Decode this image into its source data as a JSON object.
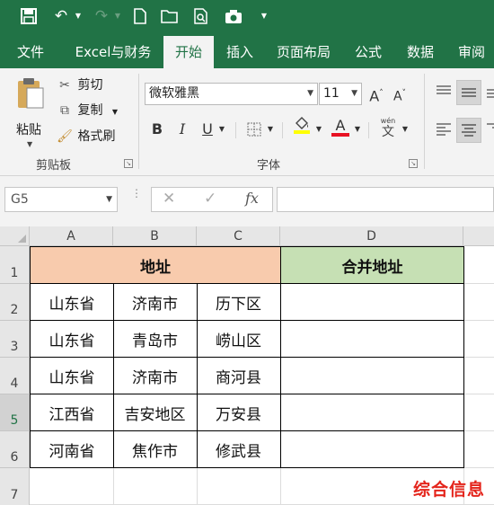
{
  "quick_access": {
    "icons": [
      "save-icon",
      "undo-icon",
      "undo-dropdown-icon",
      "redo-icon",
      "redo-dropdown-icon",
      "new-file-icon",
      "open-folder-icon",
      "print-preview-icon",
      "camera-icon",
      "customize-dropdown-icon"
    ]
  },
  "ribbon_tabs": [
    "文件",
    "Excel与财务",
    "开始",
    "插入",
    "页面布局",
    "公式",
    "数据",
    "审阅"
  ],
  "active_tab": "开始",
  "clipboard": {
    "paste_label": "粘贴",
    "cut_label": "剪切",
    "copy_label": "复制",
    "format_painter_label": "格式刷",
    "group_label": "剪贴板"
  },
  "font": {
    "font_name": "微软雅黑",
    "font_size": "11",
    "increase_label": "A",
    "decrease_label": "A",
    "bold_label": "B",
    "italic_label": "I",
    "underline_label": "U",
    "phonetic_label": "wén",
    "phonetic_char": "文",
    "font_color_label": "A",
    "fill_color": "#ffff00",
    "font_color": "#e81123",
    "group_label": "字体"
  },
  "formula_bar": {
    "name_box": "G5",
    "cancel_icon": "✕",
    "enter_icon": "✓",
    "fx_label": "fx",
    "value": ""
  },
  "sheet": {
    "columns": [
      "A",
      "B",
      "C",
      "D"
    ],
    "rows": [
      "1",
      "2",
      "3",
      "4",
      "5",
      "6",
      "7"
    ],
    "selected_row": "5",
    "header_merged_label": "地址",
    "header_merged_color": "#f8cbad",
    "header_d_label": "合并地址",
    "header_d_color": "#c6e0b4",
    "data": [
      [
        "山东省",
        "济南市",
        "历下区",
        ""
      ],
      [
        "山东省",
        "青岛市",
        "崂山区",
        ""
      ],
      [
        "山东省",
        "济南市",
        "商河县",
        ""
      ],
      [
        "江西省",
        "吉安地区",
        "万安县",
        ""
      ],
      [
        "河南省",
        "焦作市",
        "修武县",
        ""
      ]
    ]
  },
  "watermark": "综合信息"
}
